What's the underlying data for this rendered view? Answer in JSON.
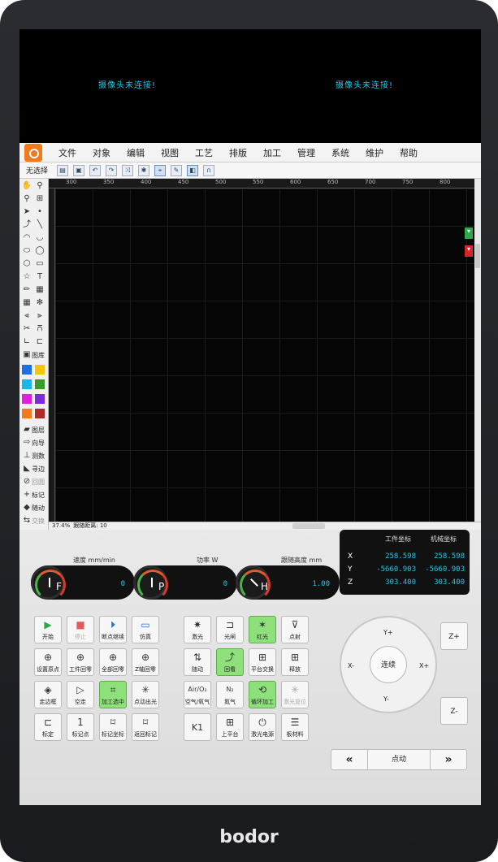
{
  "camera": {
    "left_message": "摄像头未连接!",
    "right_message": "摄像头未连接!"
  },
  "menu": [
    "文件",
    "对象",
    "编辑",
    "视图",
    "工艺",
    "排版",
    "加工",
    "管理",
    "系统",
    "维护",
    "帮助"
  ],
  "toolbar": {
    "select_label": "无选择"
  },
  "ruler": {
    "top_ticks": [
      "300",
      "350",
      "400",
      "450",
      "500",
      "550",
      "600",
      "650",
      "700",
      "750",
      "800"
    ]
  },
  "left_tools": {
    "library": "图库",
    "layers": "图层",
    "guide": "向导",
    "measure": "测数",
    "edge": "寻边",
    "undo_origin": "回圆",
    "mark": "标记",
    "follow": "随动",
    "swap": "交换"
  },
  "status": {
    "zoom": "37.4%",
    "follow_distance": "跟随距离: 10"
  },
  "gauges": {
    "speed": {
      "title": "速度 mm/min",
      "letter": "F",
      "value": "0"
    },
    "power": {
      "title": "功率 W",
      "letter": "P",
      "value": "0"
    },
    "height": {
      "title": "跟随高度 mm",
      "letter": "H",
      "value": "1.00"
    }
  },
  "coords": {
    "work_label": "工件坐标",
    "machine_label": "机械坐标",
    "rows": [
      {
        "axis": "X",
        "work": "258.598",
        "machine": "258.598"
      },
      {
        "axis": "Y",
        "work": "-5660.903",
        "machine": "-5660.903"
      },
      {
        "axis": "Z",
        "work": "303.400",
        "machine": "303.400"
      }
    ]
  },
  "buttons": [
    [
      "开始",
      "停止",
      "断点继续",
      "仿真"
    ],
    [
      "设置原点",
      "工件回零",
      "全部回零",
      "Z轴回零"
    ],
    [
      "走边框",
      "空走",
      "加工选中",
      "点动出光"
    ],
    [
      "标定",
      "标记点",
      "标记坐标",
      "返回标记"
    ]
  ],
  "laser_buttons": [
    [
      "激光",
      "光闸",
      "红光",
      "点射"
    ],
    [
      "随动",
      "回看",
      "平台交换",
      "释放"
    ],
    [
      "空气/氧气",
      "氮气",
      "循环加工",
      "激光复位"
    ],
    [
      "K1",
      "上平台",
      "激光电源",
      "板材料"
    ]
  ],
  "laser_icons": [
    [
      "Air/O₂",
      "N₂"
    ]
  ],
  "jog": {
    "up": "Y+",
    "down": "Y-",
    "left": "X-",
    "right": "X+",
    "center": "连续",
    "z_up": "Z+",
    "z_down": "Z-",
    "mode": "点动"
  },
  "brand": "bodor"
}
